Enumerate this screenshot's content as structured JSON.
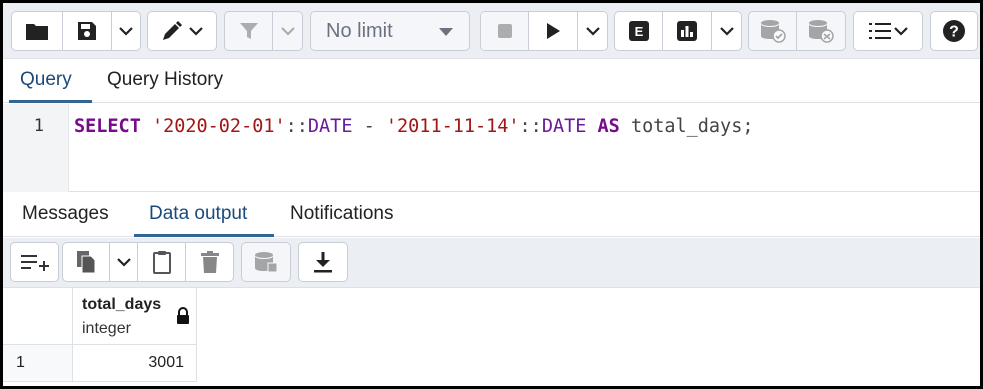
{
  "toolbar": {
    "buttons": [
      {
        "icon": "open-folder-icon"
      },
      {
        "icon": "save-icon"
      },
      {
        "icon": "chevron-down-icon"
      },
      {
        "icon": "edit-pencil-icon"
      },
      {
        "icon": "filter-icon"
      },
      {
        "icon": "stop-icon"
      },
      {
        "icon": "play-icon"
      },
      {
        "icon": "explain-icon"
      },
      {
        "icon": "explain-analyze-icon"
      },
      {
        "icon": "commit-icon"
      },
      {
        "icon": "rollback-icon"
      },
      {
        "icon": "macros-icon"
      },
      {
        "icon": "help-icon"
      }
    ],
    "limit_value": "No limit",
    "explain_label": "E",
    "help_label": "?"
  },
  "query_tabs": [
    {
      "label": "Query",
      "active": true
    },
    {
      "label": "Query History",
      "active": false
    }
  ],
  "editor": {
    "line_number": "1",
    "tokens": [
      {
        "text": "SELECT",
        "kind": "kw"
      },
      {
        "text": " ",
        "kind": "op"
      },
      {
        "text": "'2020-02-01'",
        "kind": "str"
      },
      {
        "text": "::",
        "kind": "op"
      },
      {
        "text": "DATE",
        "kind": "ty"
      },
      {
        "text": " - ",
        "kind": "op"
      },
      {
        "text": "'2011-11-14'",
        "kind": "str"
      },
      {
        "text": "::",
        "kind": "op"
      },
      {
        "text": "DATE",
        "kind": "ty"
      },
      {
        "text": " ",
        "kind": "op"
      },
      {
        "text": "AS",
        "kind": "kw"
      },
      {
        "text": " total_days;",
        "kind": "op"
      }
    ]
  },
  "output_tabs": [
    {
      "label": "Messages",
      "active": false
    },
    {
      "label": "Data output",
      "active": true
    },
    {
      "label": "Notifications",
      "active": false
    }
  ],
  "output_toolbar": {
    "buttons": [
      "add-row-icon",
      "copy-icon",
      "chevron-down-icon",
      "paste-icon",
      "delete-icon",
      "save-data-icon",
      "download-icon"
    ]
  },
  "grid": {
    "columns": [
      {
        "name": "total_days",
        "type": "integer",
        "locked": true
      }
    ],
    "rows": [
      {
        "num": "1",
        "values": [
          "3001"
        ]
      }
    ]
  },
  "colors": {
    "keyword": "#7a0a8c",
    "string": "#a31515",
    "active_tab_underline": "#326690",
    "toolbar_bg": "#ebeef3"
  }
}
